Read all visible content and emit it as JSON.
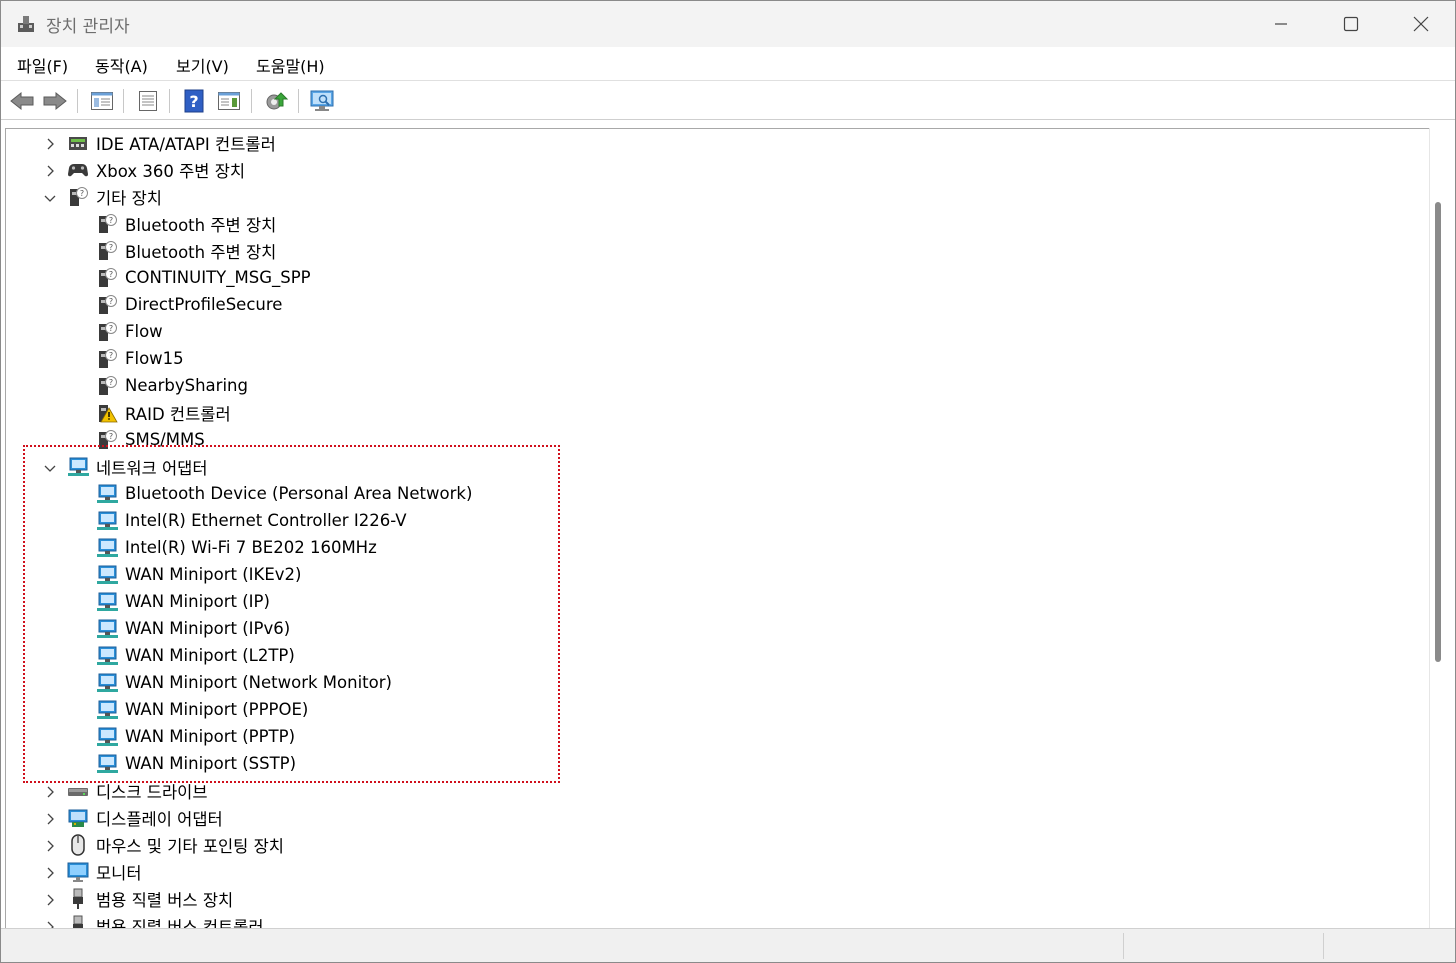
{
  "window": {
    "title": "장치 관리자"
  },
  "menu": [
    "파일(F)",
    "동작(A)",
    "보기(V)",
    "도움말(H)"
  ],
  "toolbar": [
    "back-icon",
    "forward-icon",
    "properties-pane-icon",
    "device-list-icon",
    "help-icon",
    "action-pane-icon",
    "update-driver-icon",
    "scan-hardware-icon"
  ],
  "tree": {
    "ide": {
      "label": "IDE ATA/ATAPI 컨트롤러",
      "expanded": false
    },
    "xbox": {
      "label": "Xbox 360 주변 장치",
      "expanded": false
    },
    "other": {
      "label": "기타 장치",
      "expanded": true,
      "children": [
        "Bluetooth 주변 장치",
        "Bluetooth 주변 장치",
        "CONTINUITY_MSG_SPP",
        "DirectProfileSecure",
        "Flow",
        "Flow15",
        "NearbySharing",
        "RAID 컨트롤러",
        "SMS/MMS"
      ]
    },
    "network": {
      "label": "네트워크 어댑터",
      "expanded": true,
      "children": [
        "Bluetooth Device (Personal Area Network)",
        "Intel(R) Ethernet Controller I226-V",
        "Intel(R) Wi-Fi 7 BE202 160MHz",
        "WAN Miniport (IKEv2)",
        "WAN Miniport (IP)",
        "WAN Miniport (IPv6)",
        "WAN Miniport (L2TP)",
        "WAN Miniport (Network Monitor)",
        "WAN Miniport (PPPOE)",
        "WAN Miniport (PPTP)",
        "WAN Miniport (SSTP)"
      ]
    },
    "disk": {
      "label": "디스크 드라이브",
      "expanded": false
    },
    "display": {
      "label": "디스플레이 어댑터",
      "expanded": false
    },
    "mouse": {
      "label": "마우스 및 기타 포인팅 장치",
      "expanded": false
    },
    "monitor": {
      "label": "모니터",
      "expanded": false
    },
    "usbdev": {
      "label": "범용 직렬 버스 장치",
      "expanded": false
    },
    "usbctl": {
      "label": "범용 직렬 버스 컨트롤러",
      "expanded": false
    }
  },
  "colors": {
    "highlight_border": "#d0101c",
    "network_icon": "#2a8fd8",
    "warning": "#f2c200"
  }
}
